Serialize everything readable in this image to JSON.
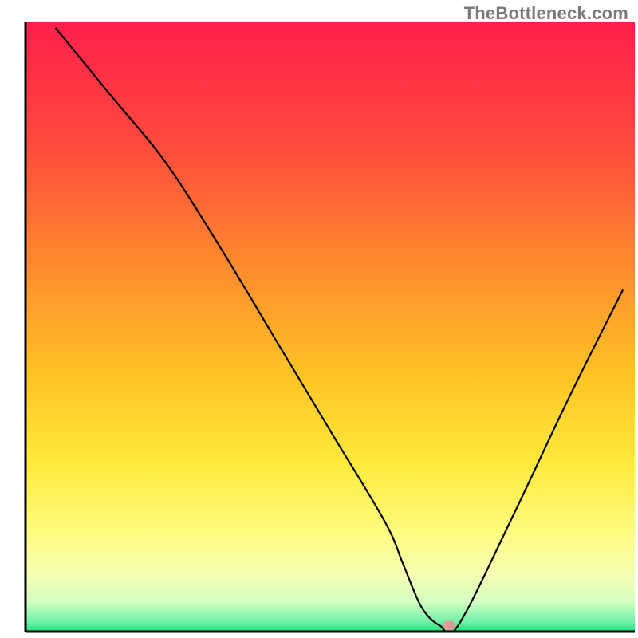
{
  "watermark": "TheBottleneck.com",
  "chart_data": {
    "type": "line",
    "title": "",
    "xlabel": "",
    "ylabel": "",
    "xlim": [
      0,
      100
    ],
    "ylim": [
      0,
      100
    ],
    "grid": false,
    "legend": false,
    "background_gradient_stops": [
      {
        "offset": 0.0,
        "color": "#ff1f4b"
      },
      {
        "offset": 0.2,
        "color": "#ff4a3d"
      },
      {
        "offset": 0.4,
        "color": "#ff8b2e"
      },
      {
        "offset": 0.58,
        "color": "#ffc324"
      },
      {
        "offset": 0.72,
        "color": "#ffe93a"
      },
      {
        "offset": 0.83,
        "color": "#fffb7a"
      },
      {
        "offset": 0.9,
        "color": "#f8ffb0"
      },
      {
        "offset": 0.95,
        "color": "#d6ffc2"
      },
      {
        "offset": 0.985,
        "color": "#6df2a8"
      },
      {
        "offset": 1.0,
        "color": "#18e07a"
      }
    ],
    "series": [
      {
        "name": "bottleneck-curve",
        "color": "#000000",
        "x": [
          5,
          14,
          23,
          32,
          41,
          50,
          59,
          62,
          65,
          68,
          71,
          80,
          89,
          98
        ],
        "values": [
          99,
          88,
          77,
          63,
          48,
          33,
          18,
          11,
          4,
          1,
          1,
          19,
          38,
          56
        ]
      }
    ],
    "marker": {
      "name": "optimal-point",
      "x": 69.5,
      "y": 1,
      "rx": 8,
      "ry": 6,
      "color": "#e39a95"
    },
    "axes": {
      "left": {
        "x": 4.0,
        "y1": 3.5,
        "y2": 99.0
      },
      "bottom": {
        "y": 99.0,
        "x1": 4.0,
        "x2": 99.5
      }
    }
  }
}
